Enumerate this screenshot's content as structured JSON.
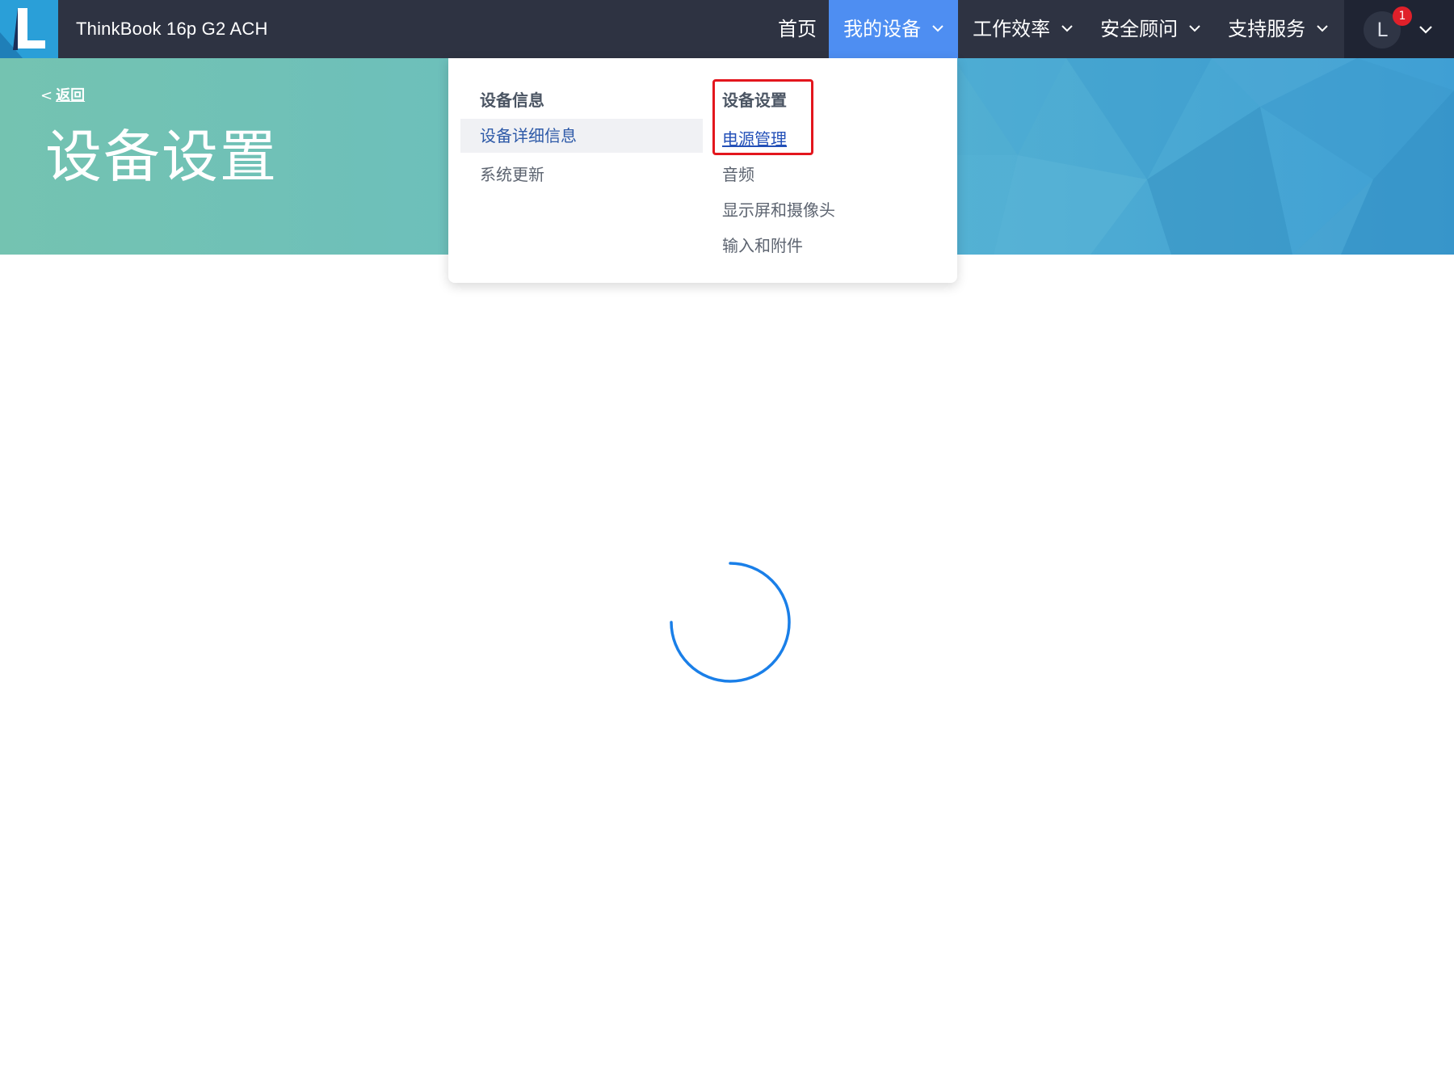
{
  "header": {
    "device_name": "ThinkBook 16p G2 ACH",
    "nav": {
      "home": "首页",
      "my_devices": "我的设备",
      "productivity": "工作效率",
      "security": "安全顾问",
      "support": "支持服务"
    },
    "user": {
      "avatar_letter": "L",
      "notification_count": "1"
    }
  },
  "hero": {
    "back_arrow": "<",
    "back_label": "返回",
    "title": "设备设置"
  },
  "dropdown": {
    "device_info": {
      "heading": "设备信息",
      "items": [
        "设备详细信息",
        "系统更新"
      ]
    },
    "device_settings": {
      "heading": "设备设置",
      "items": [
        "电源管理",
        "音频",
        "显示屏和摄像头",
        "输入和附件"
      ]
    }
  },
  "colors": {
    "topbar": "#2e3342",
    "nav_active": "#4e8ef2",
    "logo": "#2a9fd8",
    "highlight_box": "#e3161d",
    "link_active": "#2350b8",
    "spinner": "#1a7fe8"
  },
  "icons": {
    "logo": "lenovo-vantage-logo",
    "chevron": "chevron-down-icon",
    "spinner": "loading-spinner-icon"
  }
}
